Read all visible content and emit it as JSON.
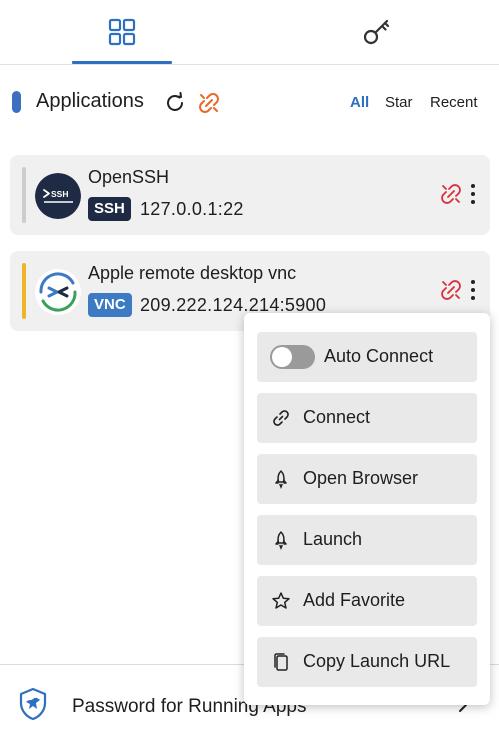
{
  "tabs": [
    {
      "icon": "grid-icon",
      "active": true
    },
    {
      "icon": "key-icon",
      "active": false
    }
  ],
  "header": {
    "title": "Applications",
    "filters": {
      "all": "All",
      "star": "Star",
      "recent": "Recent"
    },
    "active_filter": "All"
  },
  "apps": [
    {
      "name": "OpenSSH",
      "protocol": "SSH",
      "host": "127.0.0.1:22",
      "logo": "ssh-terminal-icon"
    },
    {
      "name": "Apple remote desktop vnc",
      "protocol": "VNC",
      "host": "209.222.124.214:5900",
      "logo": "remote-desktop-icon"
    }
  ],
  "menu": {
    "auto_connect": "Auto Connect",
    "auto_connect_on": false,
    "connect": "Connect",
    "open_browser": "Open Browser",
    "launch": "Launch",
    "add_favorite": "Add Favorite",
    "copy_launch_url": "Copy Launch URL"
  },
  "footer": {
    "label": "Password for Running Apps"
  },
  "colors": {
    "accent": "#2f6fc2",
    "unlink_orange": "#e8692a",
    "unlink_red": "#d9303b",
    "ssh_badge": "#1f2b45",
    "vnc_badge": "#3d7ac4",
    "vnc_bar": "#f0b429"
  }
}
